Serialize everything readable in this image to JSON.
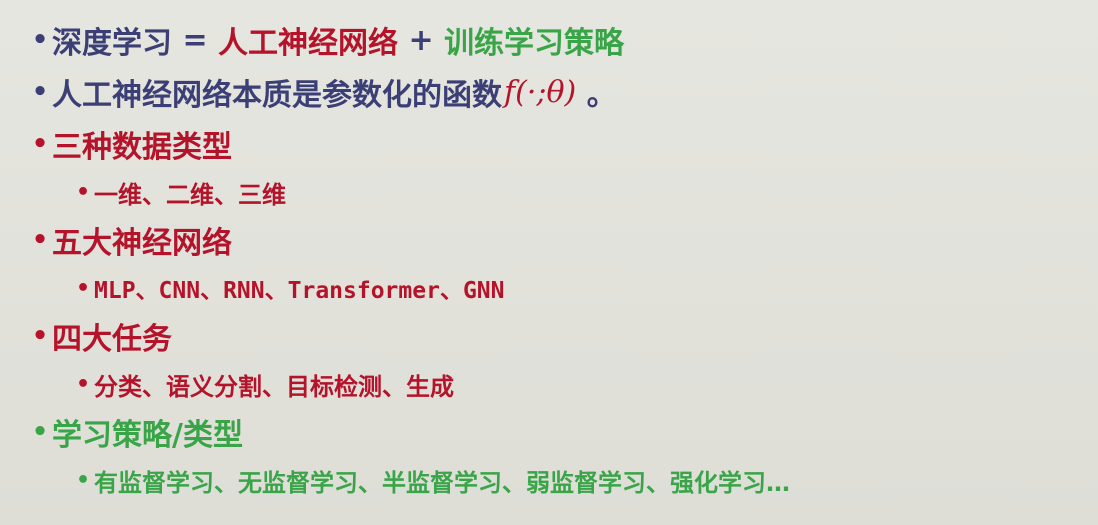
{
  "line1": {
    "left": "深度学习",
    "eq": " = ",
    "middle": "人工神经网络",
    "plus": " + ",
    "right": "训练学习策略"
  },
  "line2": {
    "text": "人工神经网络本质是参数化的函数",
    "formula_f": "f",
    "formula_args": "(·;θ)",
    "suffix": " 。"
  },
  "sections": [
    {
      "heading": "三种数据类型",
      "items": "一维、二维、三维"
    },
    {
      "heading": "五大神经网络",
      "items": "MLP、CNN、RNN、Transformer、GNN"
    },
    {
      "heading": "四大任务",
      "items": "分类、语义分割、目标检测、生成"
    },
    {
      "heading": "学习策略/类型",
      "items": "有监督学习、无监督学习、半监督学习、弱监督学习、强化学习…"
    }
  ],
  "bullet": "•",
  "colors": {
    "navy": "#3c3f75",
    "red": "#b5132a",
    "green": "#3aa548",
    "background": "#e3e3dd"
  }
}
